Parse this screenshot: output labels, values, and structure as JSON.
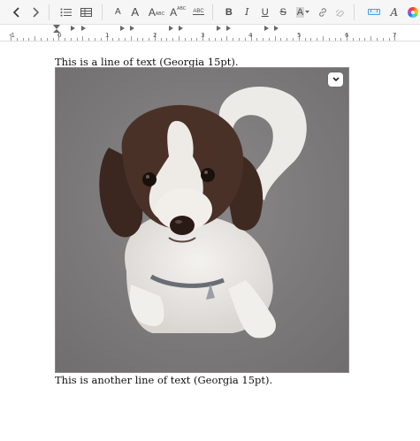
{
  "toolbar": {
    "back_icon": "chevron-left-icon",
    "forward_icon": "chevron-right-icon",
    "list_icon": "bulleted-list-icon",
    "table_icon": "table-icon",
    "font_smaller_label": "A",
    "font_larger_label": "A",
    "small_caps_label": "A",
    "small_caps_sub": "ABC",
    "superscript_label": "A",
    "superscript_sub": "ABC",
    "strikethrough_abc_label": "ABC",
    "bold_label": "B",
    "italic_label": "I",
    "underline_label": "U",
    "strike_label": "S",
    "highlight_label": "A",
    "link_icon": "link-icon",
    "unlink_icon": "unlink-icon",
    "ruler_toggle_icon": "ruler-icon",
    "font_style_label": "A",
    "color_icon": "color-wheel-icon",
    "accent_color": "#4ea1e0"
  },
  "ruler": {
    "numbers": [
      "-1",
      "0",
      "1",
      "2",
      "3",
      "4",
      "5",
      "6",
      "7"
    ]
  },
  "document": {
    "line1": "This is a line of text (Georgia 15pt).",
    "line2": "This is another line of text (Georgia 15pt).",
    "image_alt": "Photo of a brown and white fluffy dog sitting on grey carpet"
  }
}
